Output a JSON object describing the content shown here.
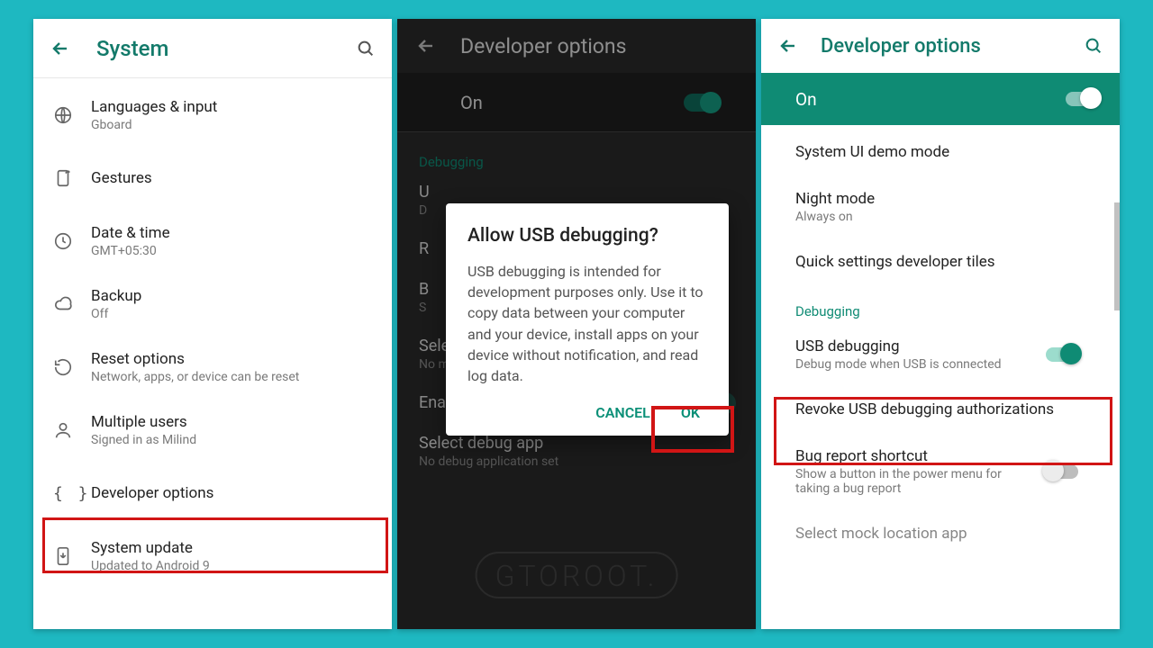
{
  "watermark": "GTOROOT.",
  "panelA": {
    "title": "System",
    "items": [
      {
        "title": "Languages & input",
        "sub": "Gboard"
      },
      {
        "title": "Gestures",
        "sub": ""
      },
      {
        "title": "Date & time",
        "sub": "GMT+05:30"
      },
      {
        "title": "Backup",
        "sub": "Off"
      },
      {
        "title": "Reset options",
        "sub": "Network, apps, or device can be reset"
      },
      {
        "title": "Multiple users",
        "sub": "Signed in as Milind"
      },
      {
        "title": "Developer options",
        "sub": ""
      },
      {
        "title": "System update",
        "sub": "Updated to Android 9"
      }
    ]
  },
  "panelB": {
    "title": "Developer options",
    "on": "On",
    "section": "Debugging",
    "usbItem": {
      "t1_partial": "U",
      "t2_partial": "D"
    },
    "item_r": "R",
    "item_b": {
      "t1": "B",
      "t2": "S"
    },
    "mock": {
      "t1": "Select mock location app",
      "t2": "No mock location app set"
    },
    "view_attr": "Enable view attribute inspection",
    "debug_app": {
      "t1": "Select debug app",
      "t2": "No debug application set"
    },
    "dialog": {
      "title": "Allow USB debugging?",
      "body": "USB debugging is intended for development purposes only. Use it to copy data between your computer and your device, install apps on your device without notification, and read log data.",
      "cancel": "CANCEL",
      "ok": "OK"
    }
  },
  "panelC": {
    "title": "Developer options",
    "on": "On",
    "items": [
      {
        "t1": "System UI demo mode",
        "t2": ""
      },
      {
        "t1": "Night mode",
        "t2": "Always on"
      },
      {
        "t1": "Quick settings developer tiles",
        "t2": ""
      }
    ],
    "section": "Debugging",
    "usb": {
      "t1": "USB debugging",
      "t2": "Debug mode when USB is connected"
    },
    "revoke": "Revoke USB debugging authorizations",
    "bugreport": {
      "t1": "Bug report shortcut",
      "t2": "Show a button in the power menu for taking a bug report"
    },
    "cutoff": "Select mock location app"
  }
}
